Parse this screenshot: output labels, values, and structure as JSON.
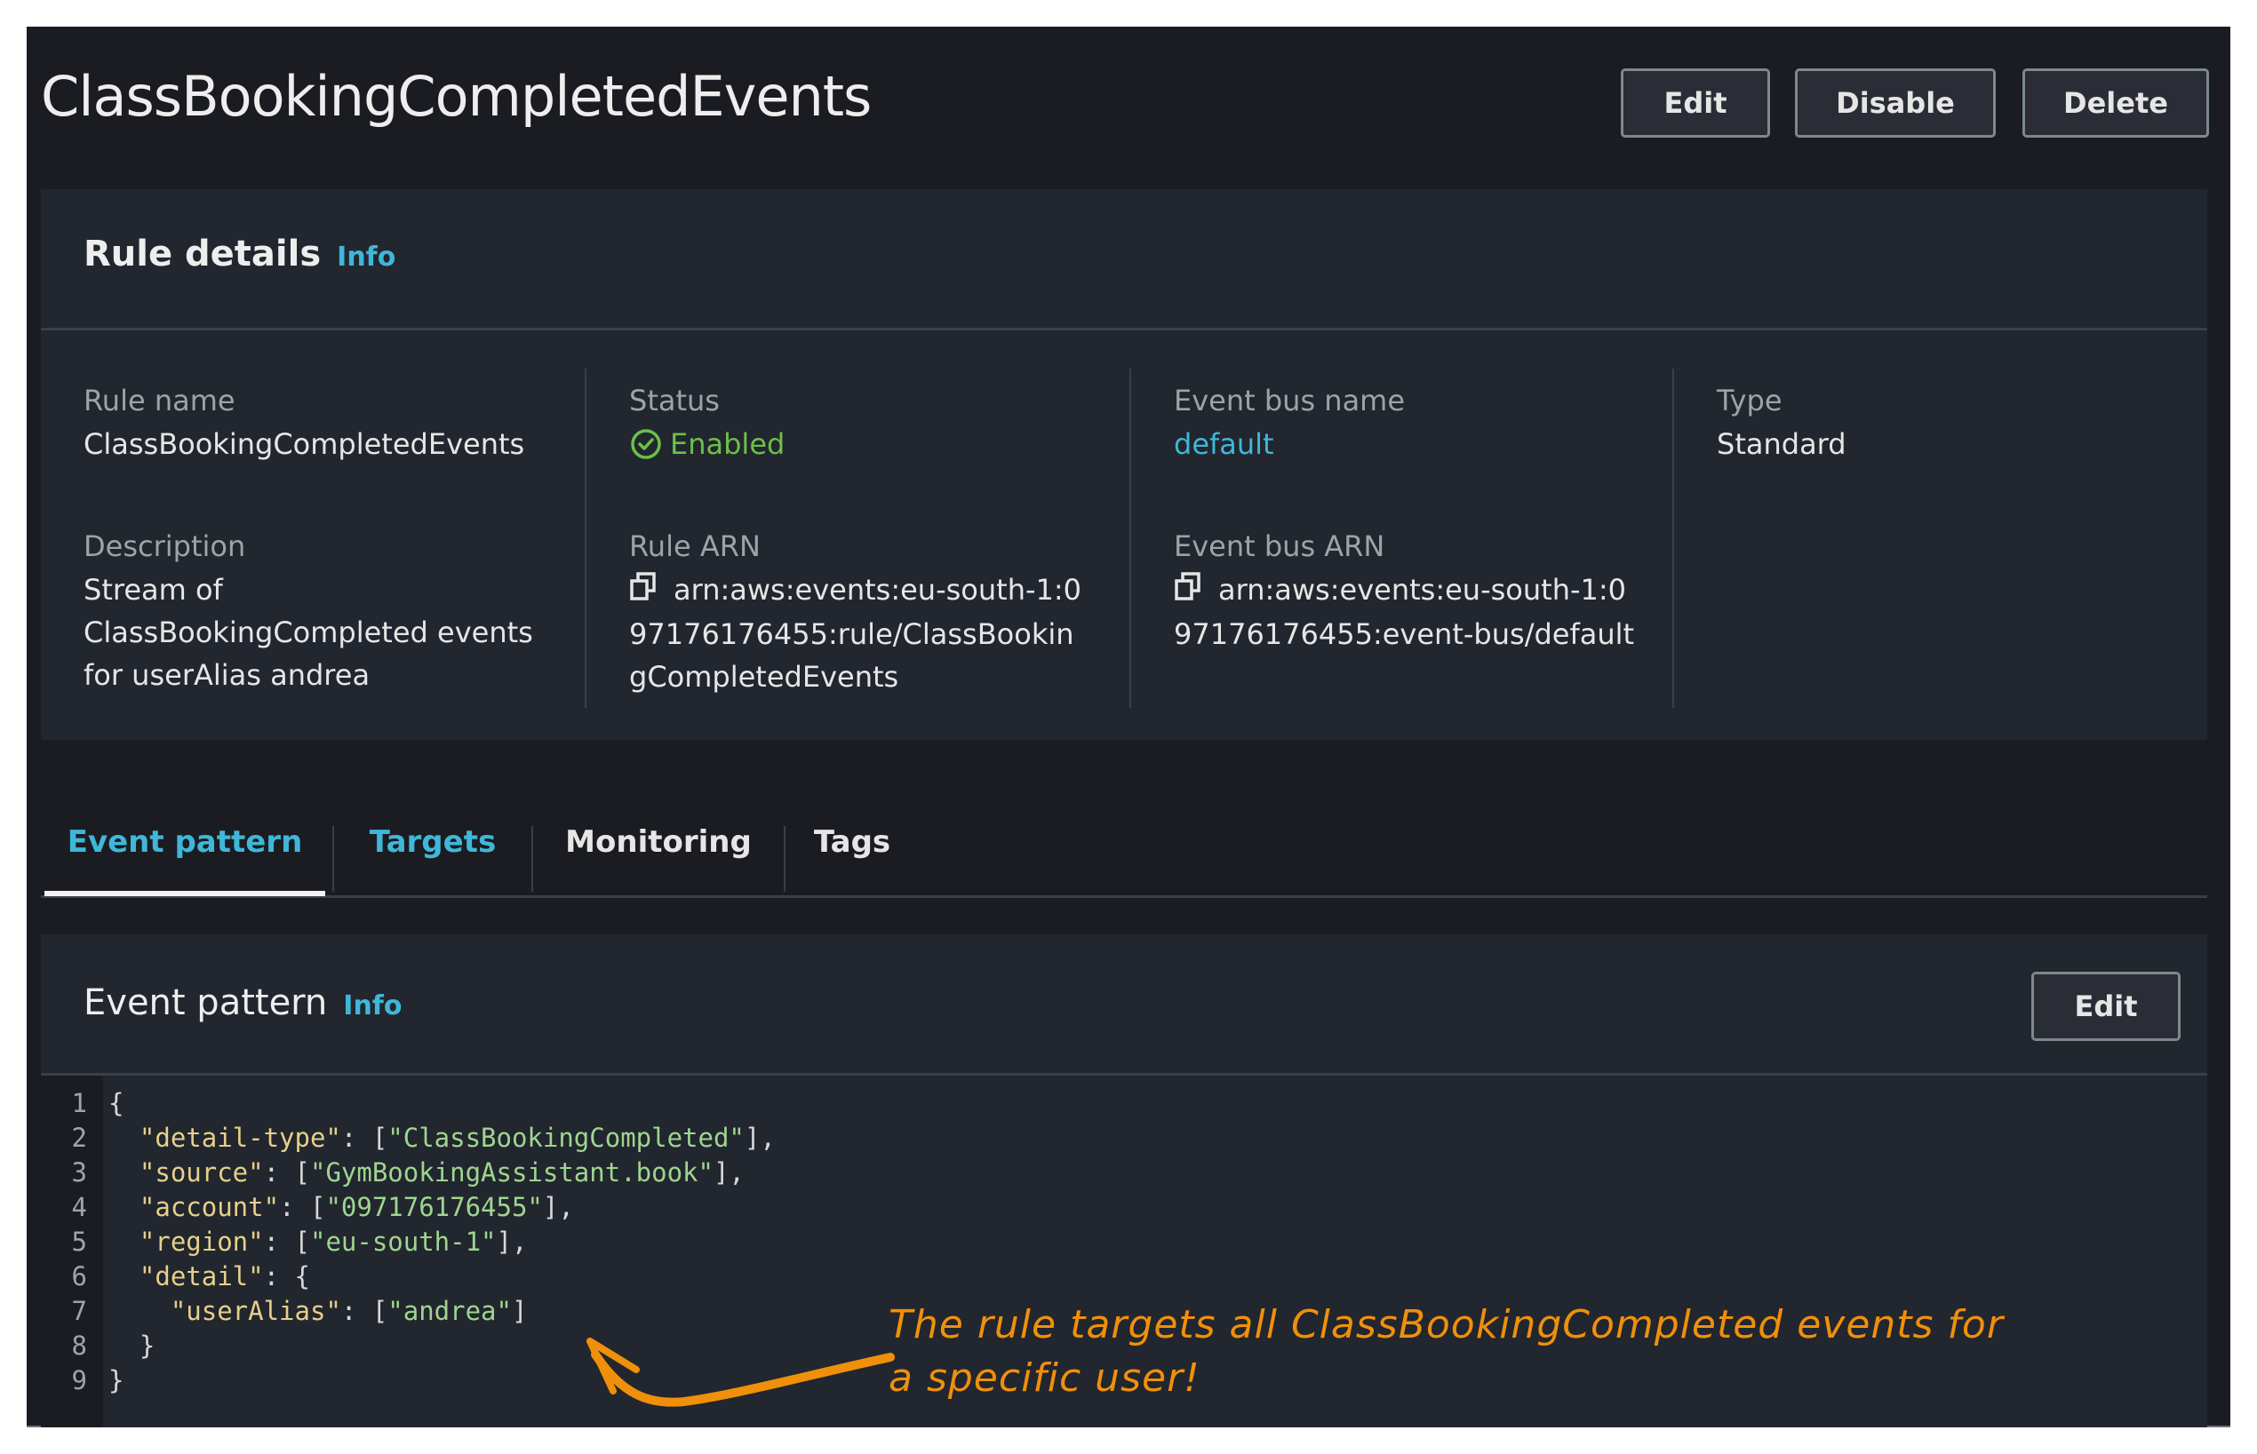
{
  "page": {
    "title": "ClassBookingCompletedEvents",
    "actions": {
      "edit": "Edit",
      "disable": "Disable",
      "delete": "Delete"
    }
  },
  "rule_details": {
    "title": "Rule details",
    "info": "Info",
    "fields": {
      "rule_name": {
        "label": "Rule name",
        "value": "ClassBookingCompletedEvents"
      },
      "status": {
        "label": "Status",
        "value": "Enabled",
        "icon": "check-circle-icon",
        "color": "#6cc04a"
      },
      "event_bus_name": {
        "label": "Event bus name",
        "value": "default"
      },
      "type": {
        "label": "Type",
        "value": "Standard"
      },
      "description": {
        "label": "Description",
        "lines": [
          "Stream of",
          "ClassBookingCompleted events",
          "for userAlias andrea"
        ]
      },
      "rule_arn": {
        "label": "Rule ARN",
        "lines": [
          "arn:aws:events:eu-south-1:0",
          "97176176455:rule/ClassBookin",
          "gCompletedEvents"
        ],
        "icon": "copy-icon"
      },
      "event_bus_arn": {
        "label": "Event bus ARN",
        "lines": [
          "arn:aws:events:eu-south-1:0",
          "97176176455:event-bus/default"
        ],
        "icon": "copy-icon"
      }
    }
  },
  "tabs": [
    {
      "label": "Event pattern",
      "active": true
    },
    {
      "label": "Targets",
      "active": false
    },
    {
      "label": "Monitoring",
      "active": false
    },
    {
      "label": "Tags",
      "active": false
    }
  ],
  "event_pattern": {
    "title": "Event pattern",
    "info": "Info",
    "edit": "Edit",
    "code_lines": [
      {
        "n": "1",
        "indent": "",
        "parts": [
          [
            "p",
            "{"
          ]
        ]
      },
      {
        "n": "2",
        "indent": "  ",
        "parts": [
          [
            "k",
            "\"detail-type\""
          ],
          [
            "p",
            ": ["
          ],
          [
            "s",
            "\"ClassBookingCompleted\""
          ],
          [
            "p",
            "],"
          ]
        ]
      },
      {
        "n": "3",
        "indent": "  ",
        "parts": [
          [
            "k",
            "\"source\""
          ],
          [
            "p",
            ": ["
          ],
          [
            "s",
            "\"GymBookingAssistant.book\""
          ],
          [
            "p",
            "],"
          ]
        ]
      },
      {
        "n": "4",
        "indent": "  ",
        "parts": [
          [
            "k",
            "\"account\""
          ],
          [
            "p",
            ": ["
          ],
          [
            "s",
            "\"097176176455\""
          ],
          [
            "p",
            "],"
          ]
        ]
      },
      {
        "n": "5",
        "indent": "  ",
        "parts": [
          [
            "k",
            "\"region\""
          ],
          [
            "p",
            ": ["
          ],
          [
            "s",
            "\"eu-south-1\""
          ],
          [
            "p",
            "],"
          ]
        ]
      },
      {
        "n": "6",
        "indent": "  ",
        "parts": [
          [
            "k",
            "\"detail\""
          ],
          [
            "p",
            ": {"
          ]
        ]
      },
      {
        "n": "7",
        "indent": "    ",
        "parts": [
          [
            "k",
            "\"userAlias\""
          ],
          [
            "p",
            ": ["
          ],
          [
            "s",
            "\"andrea\""
          ],
          [
            "p",
            "]"
          ]
        ]
      },
      {
        "n": "8",
        "indent": "  ",
        "parts": [
          [
            "p",
            "}"
          ]
        ]
      },
      {
        "n": "9",
        "indent": "",
        "parts": [
          [
            "p",
            "}"
          ]
        ]
      }
    ]
  },
  "annotation": {
    "lines": [
      "The rule targets all ClassBookingCompleted events for",
      "a specific user!"
    ],
    "color": "#f0900a"
  }
}
